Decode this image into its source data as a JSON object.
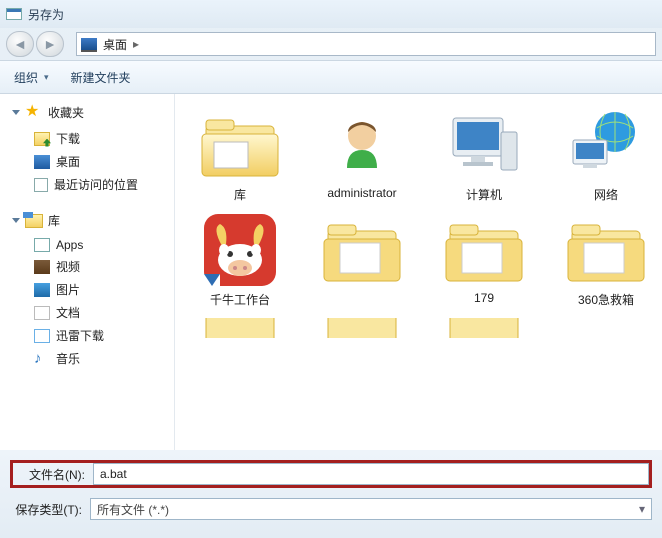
{
  "title": "另存为",
  "breadcrumb": {
    "location": "桌面"
  },
  "toolbar": {
    "organize": "组织",
    "newfolder": "新建文件夹"
  },
  "sidebar": {
    "favorites": {
      "label": "收藏夹",
      "download": "下载",
      "desktop": "桌面",
      "recent": "最近访问的位置"
    },
    "libraries": {
      "label": "库",
      "apps": "Apps",
      "videos": "视频",
      "pictures": "图片",
      "documents": "文档",
      "xunlei": "迅雷下载",
      "music": "音乐"
    }
  },
  "items": {
    "lib": "库",
    "admin": "administrator",
    "computer": "计算机",
    "network": "网络",
    "qianniu": "千牛工作台",
    "f179": "179",
    "f360": "360急救箱"
  },
  "footer": {
    "filename_label": "文件名(N):",
    "filename_value": "a.bat",
    "filetype_label": "保存类型(T):",
    "filetype_value": "所有文件 (*.*)"
  }
}
